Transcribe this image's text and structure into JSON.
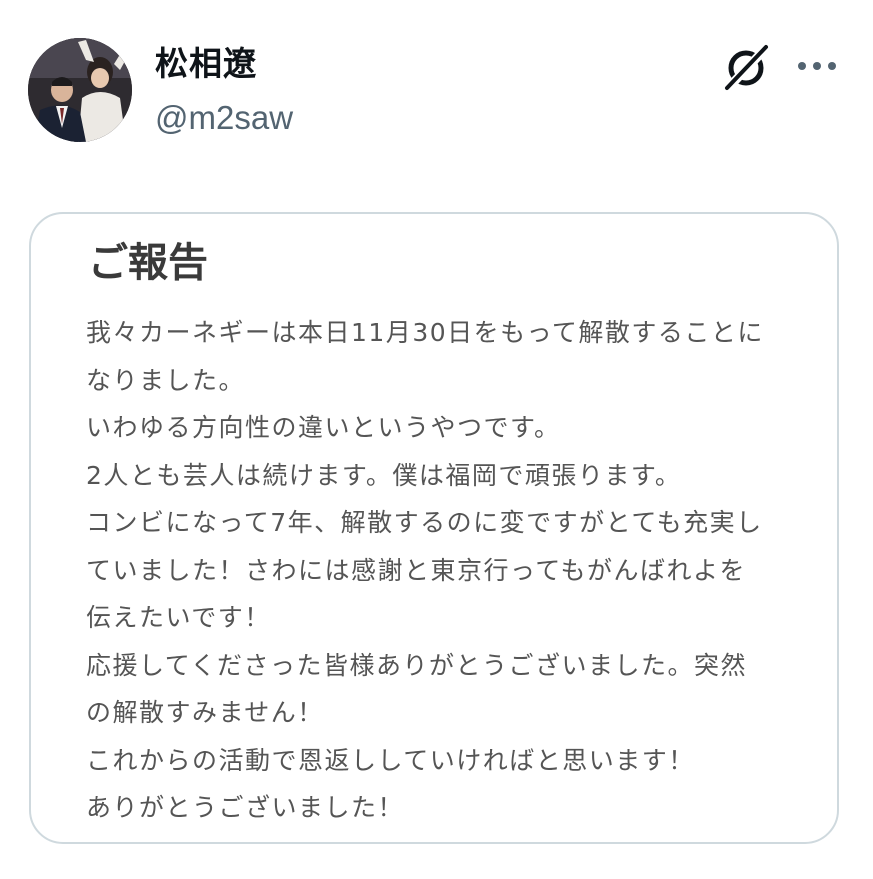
{
  "profile": {
    "display_name": "松相遼",
    "handle": "@m2saw"
  },
  "icons": {
    "grok": "grok-icon",
    "more": "more-icon"
  },
  "card": {
    "title": "ご報告",
    "lines": [
      "我々カーネギーは本日11月30日をもって解散することに",
      "なりました。",
      "いわゆる方向性の違いというやつです。",
      "2人とも芸人は続けます。僕は福岡で頑張ります。",
      "コンビになって7年、解散するのに変ですがとても充実し",
      "ていました！さわには感謝と東京行ってもがんばれよを",
      "伝えたいです！",
      "応援してくださった皆様ありがとうございました。突然",
      "の解散すみません！",
      "これからの活動で恩返ししていければと思います！",
      "ありがとうございました！"
    ]
  },
  "colors": {
    "name_text": "#0f1419",
    "handle_text": "#536471",
    "card_border": "#cfd9de",
    "card_text": "#555555"
  }
}
